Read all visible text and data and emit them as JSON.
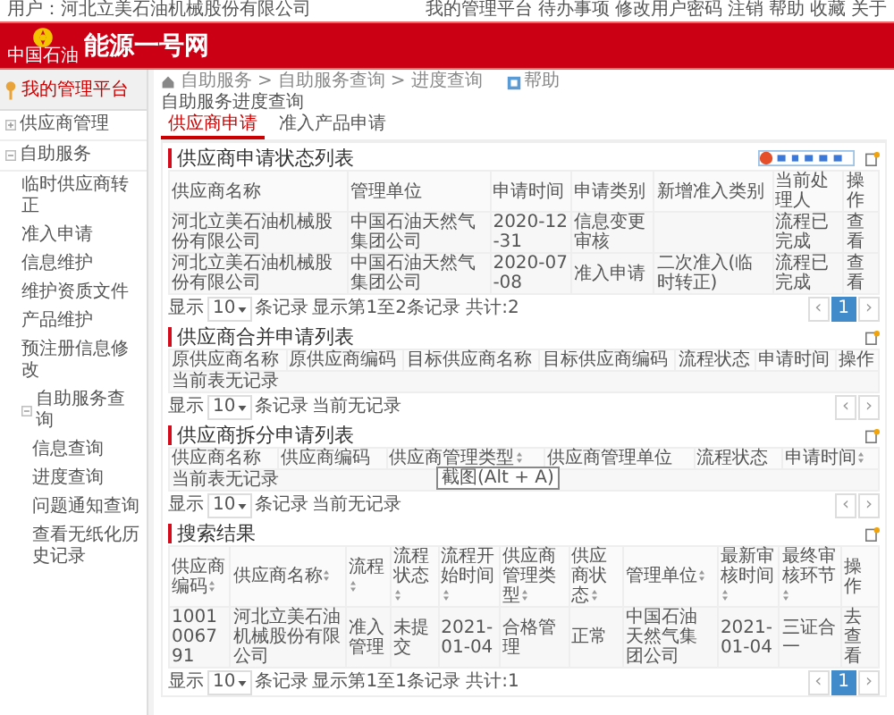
{
  "top_bar": {
    "user": "用户：河北立美石油机械股份有限公司",
    "links": [
      "我的管理平台",
      "待办事项",
      "修改用户密码",
      "注销",
      "帮助",
      "收藏",
      "关于"
    ]
  },
  "header": {
    "logo": "能源一号网",
    "emblem_caption": "中国石油"
  },
  "sidebar": {
    "title": "我的管理平台",
    "items": [
      {
        "label": "供应商管理",
        "expanded": false
      },
      {
        "label": "自助服务",
        "expanded": true,
        "children": [
          {
            "label": "临时供应商转正"
          },
          {
            "label": "准入申请"
          },
          {
            "label": "信息维护"
          },
          {
            "label": "维护资质文件"
          },
          {
            "label": "产品维护"
          },
          {
            "label": "预注册信息修改"
          },
          {
            "label": "自助服务查询",
            "expanded": true,
            "children": [
              {
                "label": "信息查询"
              },
              {
                "label": "进度查询"
              },
              {
                "label": "问题通知查询"
              },
              {
                "label": "查看无纸化历史记录"
              }
            ]
          }
        ]
      }
    ]
  },
  "breadcrumb": {
    "items": [
      "自助服务",
      "自助服务查询",
      "进度查询"
    ],
    "separator": ">",
    "help": "帮助"
  },
  "page_title": "自助服务进度查询",
  "tabs": [
    {
      "label": "供应商申请",
      "selected": true
    },
    {
      "label": "准入产品申请",
      "selected": false
    }
  ],
  "sections": [
    {
      "title": "供应商申请状态列表",
      "columns": [
        {
          "label": "供应商名称",
          "sortable": false
        },
        {
          "label": "管理单位",
          "sortable": false
        },
        {
          "label": "申请时间",
          "sortable": false
        },
        {
          "label": "申请类别",
          "sortable": false
        },
        {
          "label": "新增准入类别",
          "sortable": false
        },
        {
          "label": "当前处理人",
          "sortable": false
        },
        {
          "label": "操作",
          "sortable": false
        }
      ],
      "rows": [
        [
          "河北立美石油机械股份有限公司",
          "中国石油天然气集团公司",
          "2020-12-31",
          "信息变更审核",
          "",
          "流程已完成",
          "查看"
        ],
        [
          "河北立美石油机械股份有限公司",
          "中国石油天然气集团公司",
          "2020-07-08",
          "准入申请",
          "二次准入(临时转正)",
          "流程已完成",
          "查看"
        ]
      ],
      "pager": {
        "show": "显示",
        "length": "10",
        "unit": "条记录",
        "info": "显示第1至2条记录 共计:2",
        "prev": "‹",
        "next": "›",
        "pages": [
          {
            "label": "1",
            "selected": true
          }
        ]
      }
    },
    {
      "title": "供应商合并申请列表",
      "columns": [
        {
          "label": "原供应商名称",
          "sortable": false
        },
        {
          "label": "原供应商编码",
          "sortable": false
        },
        {
          "label": "目标供应商名称",
          "sortable": false
        },
        {
          "label": "目标供应商编码",
          "sortable": false
        },
        {
          "label": "流程状态",
          "sortable": false
        },
        {
          "label": "申请时间",
          "sortable": false
        },
        {
          "label": "操作",
          "sortable": false
        }
      ],
      "empty_text": "当前表无记录",
      "pager": {
        "show": "显示",
        "length": "10",
        "unit": "条记录",
        "info": "当前无记录",
        "prev": "‹",
        "next": "›"
      }
    },
    {
      "title": "供应商拆分申请列表",
      "columns": [
        {
          "label": "供应商名称",
          "sortable": false
        },
        {
          "label": "供应商编码",
          "sortable": false
        },
        {
          "label": "供应商管理类型",
          "sortable": true
        },
        {
          "label": "供应商管理单位",
          "sortable": false
        },
        {
          "label": "流程状态",
          "sortable": false
        },
        {
          "label": "申请时间",
          "sortable": true
        }
      ],
      "empty_text": "当前表无记录",
      "tooltip": "截图(Alt + A)",
      "pager": {
        "show": "显示",
        "length": "10",
        "unit": "条记录",
        "info": "当前无记录",
        "prev": "‹",
        "next": "›"
      }
    },
    {
      "title": "搜索结果",
      "columns": [
        {
          "label": "供应商编码",
          "sortable": true
        },
        {
          "label": "供应商名称",
          "sortable": true
        },
        {
          "label": "流程",
          "sortable": true
        },
        {
          "label": "流程状态",
          "sortable": true
        },
        {
          "label": "流程开始时间",
          "sortable": true
        },
        {
          "label": "供应商管理类型",
          "sortable": true
        },
        {
          "label": "供应商状态",
          "sortable": true
        },
        {
          "label": "管理单位",
          "sortable": true
        },
        {
          "label": "最新审核时间",
          "sortable": true
        },
        {
          "label": "最终审核环节",
          "sortable": true
        },
        {
          "label": "操作",
          "sortable": false
        }
      ],
      "rows": [
        [
          "1001006791",
          "河北立美石油机械股份有限公司",
          "准入管理",
          "未提交",
          "2021-01-04",
          "合格管理",
          "正常",
          "中国石油天然气集团公司",
          "2021-01-04",
          "三证合一",
          "去查看"
        ]
      ],
      "pager": {
        "show": "显示",
        "length": "10",
        "unit": "条记录",
        "info": "显示第1至1条记录 共计:1",
        "prev": "‹",
        "next": "›",
        "pages": [
          {
            "label": "1",
            "selected": true
          }
        ]
      }
    }
  ]
}
